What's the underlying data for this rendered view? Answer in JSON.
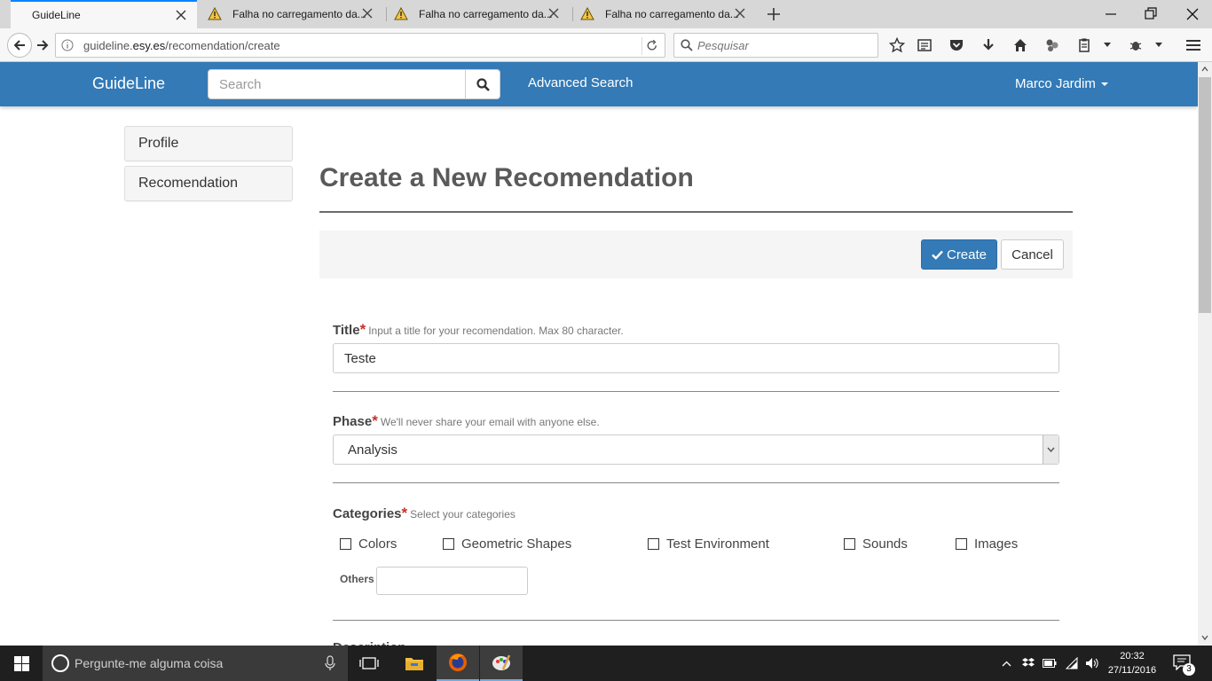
{
  "browser": {
    "tabs": [
      {
        "title": "GuideLine",
        "active": true
      },
      {
        "title": "Falha no carregamento da...",
        "active": false
      },
      {
        "title": "Falha no carregamento da...",
        "active": false
      },
      {
        "title": "Falha no carregamento da...",
        "active": false
      }
    ],
    "url_prefix": "guideline.",
    "url_domain": "esy.es",
    "url_path": "/recomendation/create",
    "search_placeholder": "Pesquisar"
  },
  "app": {
    "brand": "GuideLine",
    "search_placeholder": "Search",
    "advanced_search": "Advanced Search",
    "user_name": "Marco Jardim",
    "accent_color": "#337ab7"
  },
  "sidebar": {
    "items": [
      {
        "label": "Profile"
      },
      {
        "label": "Recomendation"
      }
    ]
  },
  "main": {
    "title": "Create a New Recomendation",
    "create_label": "Create",
    "cancel_label": "Cancel",
    "title_field": {
      "label": "Title",
      "required_mark": "*",
      "hint": "Input a title for your recomendation. Max 80 character.",
      "value": "Teste"
    },
    "phase_field": {
      "label": "Phase",
      "required_mark": "*",
      "hint": "We'll never share your email with anyone else.",
      "value": "Analysis"
    },
    "categories_field": {
      "label": "Categories",
      "required_mark": "*",
      "hint": "Select your categories",
      "options": [
        "Colors",
        "Geometric Shapes",
        "Test Environment",
        "Sounds",
        "Images"
      ],
      "others_label": "Others",
      "others_value": ""
    },
    "next_field_label": "Description"
  },
  "taskbar": {
    "search_placeholder": "Pergunte-me alguma coisa",
    "time": "20:32",
    "date": "27/11/2016",
    "notification_count": "3"
  }
}
